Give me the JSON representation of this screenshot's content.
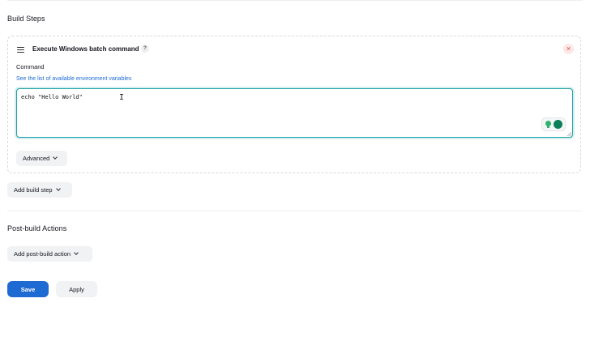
{
  "build_steps": {
    "title": "Build Steps",
    "step": {
      "title": "Execute Windows batch command",
      "help_symbol": "?",
      "close_symbol": "×",
      "command_label": "Command",
      "env_link": "See the list of available environment variables",
      "command_value": "echo \"Hello World\"",
      "advanced_label": "Advanced"
    },
    "add_step_label": "Add build step"
  },
  "post_build": {
    "title": "Post-build Actions",
    "add_action_label": "Add post-build action"
  },
  "actions": {
    "save_label": "Save",
    "apply_label": "Apply"
  },
  "icons": {
    "drag": "drag-handle-icon",
    "help": "help-icon",
    "close": "close-icon",
    "chevron": "chevron-down-icon",
    "suggestion": "lightbulb-icon",
    "assistant": "grammar-assistant-icon"
  },
  "colors": {
    "primary": "#1e6ad3",
    "focus_border": "#1ba0a8",
    "close": "#e03e3e",
    "link": "#1e6ad3"
  }
}
